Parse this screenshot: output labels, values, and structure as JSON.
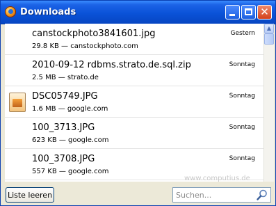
{
  "window": {
    "title": "Downloads",
    "title_icon": "firefox-icon",
    "controls": [
      "minimize-icon",
      "maximize-icon",
      "close-icon"
    ],
    "close_glyph": "✕"
  },
  "downloads": [
    {
      "name": "canstockphoto3841601.jpg",
      "meta": "29.8 KB — canstockphoto.com",
      "date": "Gestern",
      "icon": "none"
    },
    {
      "name": "2010-09-12 rdbms.strato.de.sql.zip",
      "meta": "2.5 MB — strato.de",
      "date": "Sonntag",
      "icon": "none"
    },
    {
      "name": "DSC05749.JPG",
      "meta": "1.6 MB — google.com",
      "date": "Sonntag",
      "icon": "image-file-icon"
    },
    {
      "name": "100_3713.JPG",
      "meta": "623 KB — google.com",
      "date": "Sonntag",
      "icon": "none"
    },
    {
      "name": "100_3708.JPG",
      "meta": "557 KB — google.com",
      "date": "Sonntag",
      "icon": "none"
    }
  ],
  "watermark": "www.computius.de",
  "footer": {
    "clear_button": "Liste leeren",
    "search_placeholder": "Suchen..."
  },
  "colors": {
    "titlebar": "#0a52d8",
    "close_button": "#d4401b",
    "window_background": "#ece9d8"
  }
}
